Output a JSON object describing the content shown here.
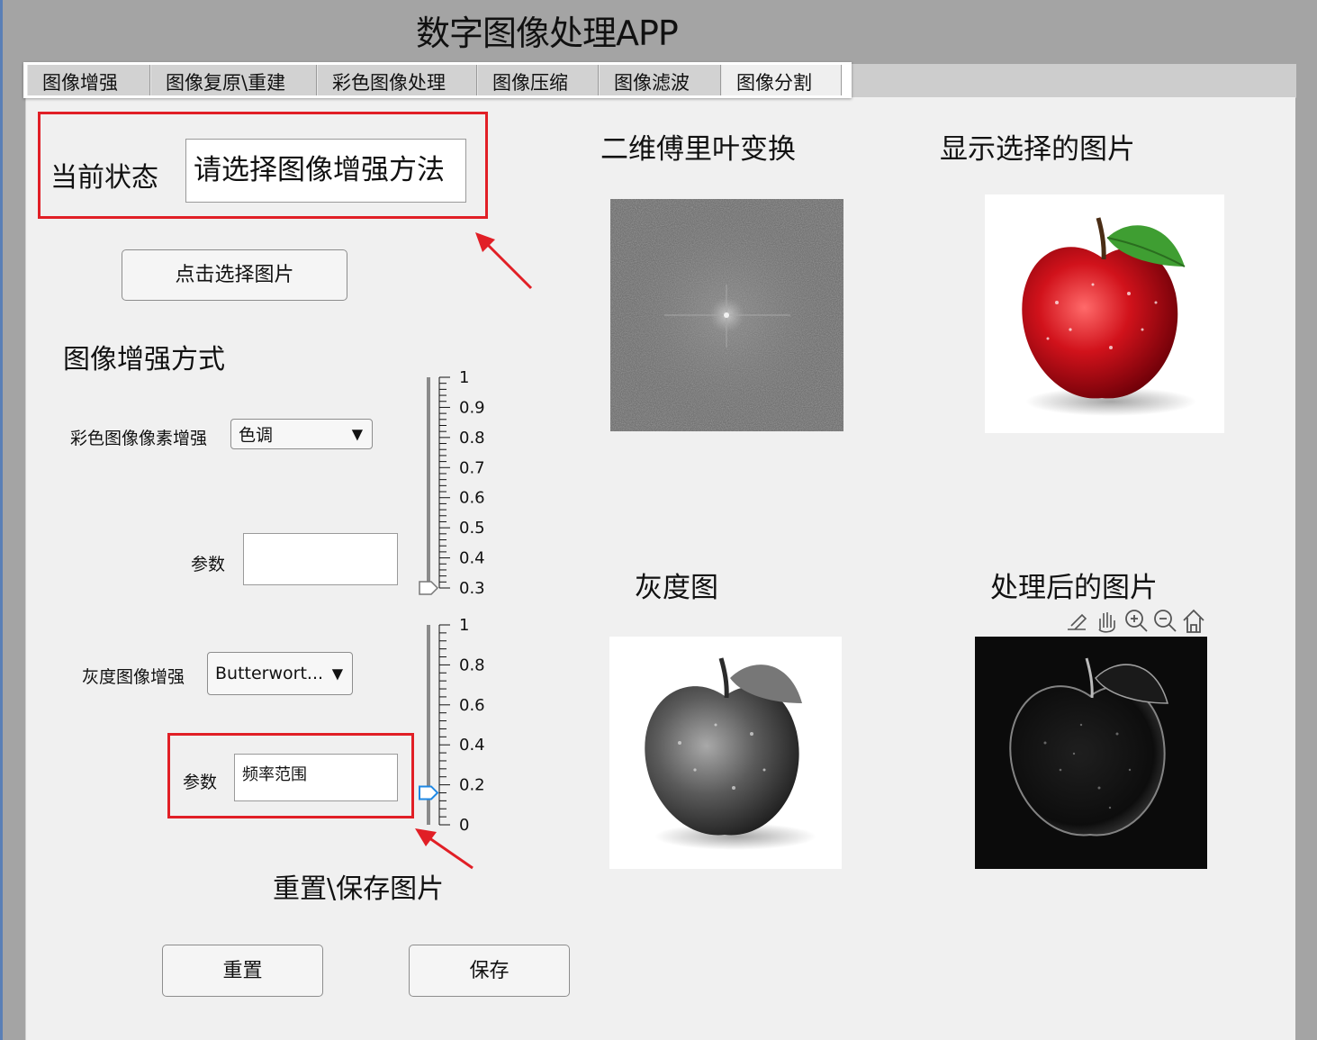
{
  "app": {
    "title": "数字图像处理APP"
  },
  "tabs": [
    {
      "label": "图像增强"
    },
    {
      "label": "图像复原\\重建"
    },
    {
      "label": "彩色图像处理"
    },
    {
      "label": "图像压缩"
    },
    {
      "label": "图像滤波"
    },
    {
      "label": "图像分割"
    }
  ],
  "status": {
    "label": "当前状态",
    "value": "请选择图像增强方法"
  },
  "select_image_button": "点击选择图片",
  "enhance": {
    "section_title": "图像增强方式",
    "color": {
      "label": "彩色图像像素增强",
      "dropdown_value": "色调",
      "param_label": "参数",
      "param_value": ""
    },
    "gray": {
      "label": "灰度图像增强",
      "dropdown_value": "Butterwort...",
      "param_label": "参数",
      "param_value": "频率范围"
    }
  },
  "slider1": {
    "ticks": [
      "1",
      "0.9",
      "0.8",
      "0.7",
      "0.6",
      "0.5",
      "0.4",
      "0.3"
    ],
    "value": 0.3,
    "min": 0.3,
    "max": 1
  },
  "slider2": {
    "ticks": [
      "1",
      "0.8",
      "0.6",
      "0.4",
      "0.2",
      "0"
    ],
    "value": 0.16,
    "min": 0,
    "max": 1
  },
  "reset_save": {
    "section_title": "重置\\保存图片",
    "reset_label": "重置",
    "save_label": "保存"
  },
  "panels": {
    "fft_title": "二维傅里叶变换",
    "selected_title": "显示选择的图片",
    "gray_title": "灰度图",
    "processed_title": "处理后的图片"
  },
  "axes_toolbar": [
    "edit-icon",
    "pan-icon",
    "zoom-in-icon",
    "zoom-out-icon",
    "home-icon"
  ],
  "colors": {
    "highlight_red": "#e11f26",
    "slider_thumb_blue": "#1e88e5"
  }
}
